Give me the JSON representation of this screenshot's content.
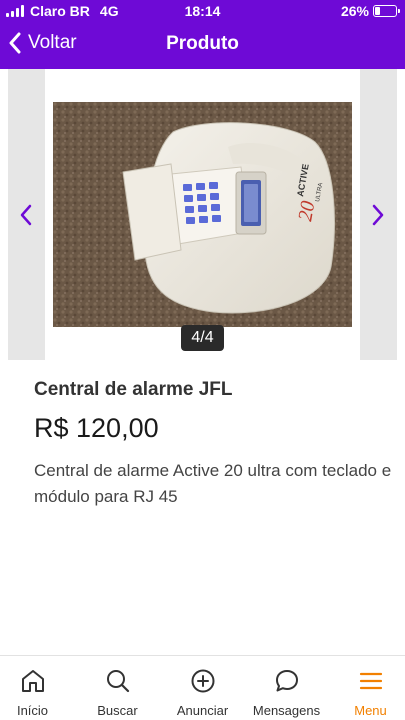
{
  "status": {
    "carrier": "Claro BR",
    "network": "4G",
    "time": "18:14",
    "battery": "26%",
    "battery_level": 0.26
  },
  "nav": {
    "back_label": "Voltar",
    "title": "Produto"
  },
  "gallery": {
    "counter": "4/4",
    "image_text": {
      "brand": "ACTIVE",
      "model": "20",
      "variant": "ULTRA"
    }
  },
  "product": {
    "title": "Central de alarme JFL",
    "price": "R$ 120,00",
    "description": "Central de alarme Active 20 ultra com teclado e módulo para RJ 45"
  },
  "tabs": [
    {
      "label": "Início",
      "icon": "home-icon"
    },
    {
      "label": "Buscar",
      "icon": "search-icon"
    },
    {
      "label": "Anunciar",
      "icon": "plus-circle-icon"
    },
    {
      "label": "Mensagens",
      "icon": "chat-bubble-icon"
    },
    {
      "label": "Menu",
      "icon": "menu-icon"
    }
  ],
  "colors": {
    "brand": "#6e0ad6",
    "accent": "#f28000",
    "nav_arrow": "#6e0ad6"
  }
}
